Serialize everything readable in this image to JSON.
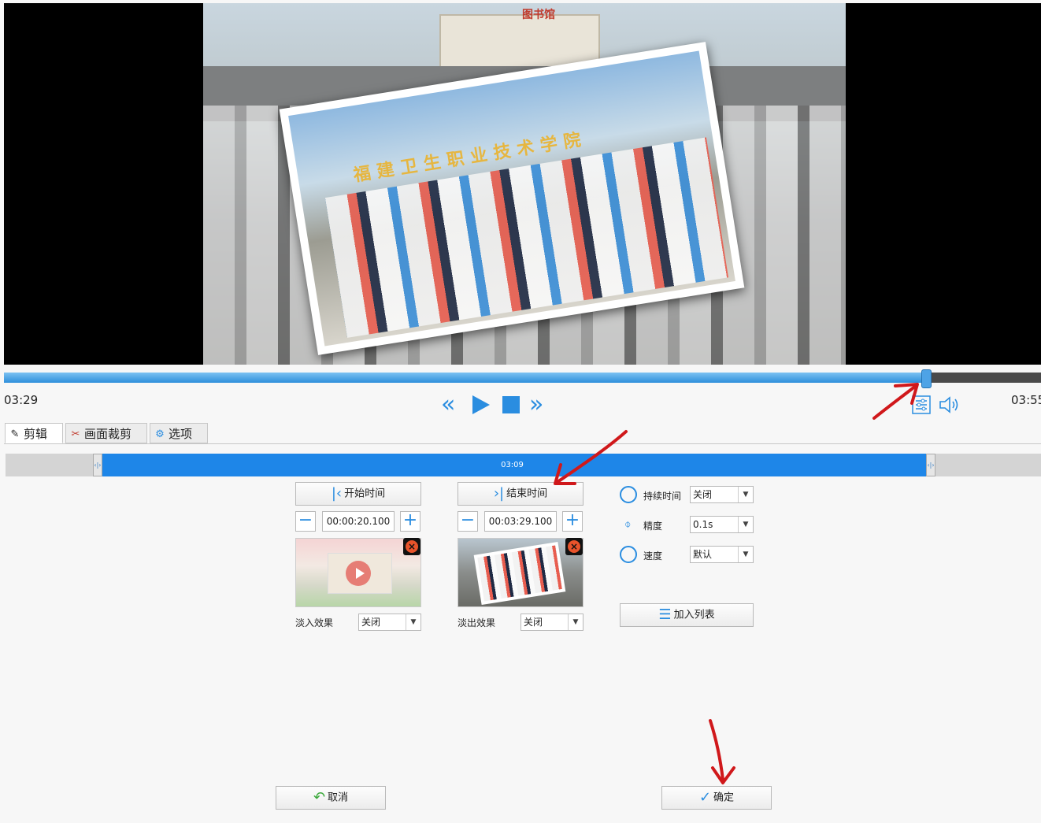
{
  "player": {
    "current_time": "03:29",
    "total_time": "03:55",
    "progress_fraction": 0.889
  },
  "video_frame": {
    "sign_text": "图书馆",
    "banner_text": "福建卫生职业技术学院"
  },
  "tabs": [
    {
      "label": "剪辑",
      "icon": "edit-icon"
    },
    {
      "label": "画面裁剪",
      "icon": "crop-icon"
    },
    {
      "label": "选项",
      "icon": "gear-icon"
    }
  ],
  "timeline": {
    "selection_duration": "03:09",
    "start_fraction": 0.0897,
    "end_fraction": 0.889
  },
  "start": {
    "button_label": "开始时间",
    "time_value": "00:00:20.100",
    "effect_label": "淡入效果",
    "effect_value": "关闭"
  },
  "end": {
    "button_label": "结束时间",
    "time_value": "00:03:29.100",
    "effect_label": "淡出效果",
    "effect_value": "关闭"
  },
  "options": {
    "duration_label": "持续时间",
    "duration_value": "关闭",
    "precision_label": "精度",
    "precision_value": "0.1s",
    "speed_label": "速度",
    "speed_value": "默认",
    "add_list_label": "加入列表"
  },
  "footer": {
    "cancel_label": "取消",
    "ok_label": "确定"
  },
  "colors": {
    "accent": "#1e86e8",
    "annotation": "#d0181b"
  }
}
